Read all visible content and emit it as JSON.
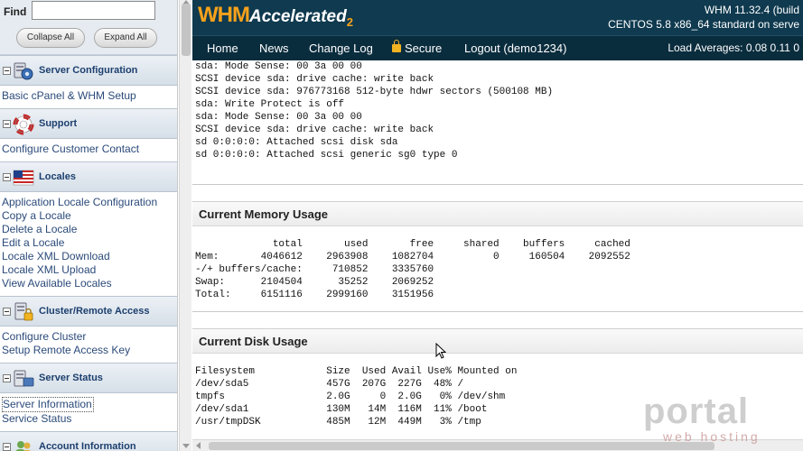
{
  "sidebar": {
    "find_label": "Find",
    "find_value": "",
    "collapse_label": "Collapse All",
    "expand_label": "Expand All",
    "sections": [
      {
        "title": "Server Configuration",
        "items": [
          "Basic cPanel & WHM Setup"
        ]
      },
      {
        "title": "Support",
        "items": [
          "Configure Customer Contact"
        ]
      },
      {
        "title": "Locales",
        "items": [
          "Application Locale Configuration",
          "Copy a Locale",
          "Delete a Locale",
          "Edit a Locale",
          "Locale XML Download",
          "Locale XML Upload",
          "View Available Locales"
        ]
      },
      {
        "title": "Cluster/Remote Access",
        "items": [
          "Configure Cluster",
          "Setup Remote Access Key"
        ]
      },
      {
        "title": "Server Status",
        "items": [
          "Server Information",
          "Service Status"
        ]
      },
      {
        "title": "Account Information",
        "items": []
      }
    ]
  },
  "header": {
    "logo_main": "WHM",
    "logo_accent": "Accelerated",
    "logo_num": "2",
    "version_line1": "WHM 11.32.4 (build",
    "version_line2": "CENTOS 5.8 x86_64 standard on serve"
  },
  "nav": {
    "items": [
      "Home",
      "News",
      "Change Log",
      "Secure",
      "Logout (demo1234)"
    ],
    "load_averages": "Load Averages: 0.08 0.11 0"
  },
  "dmesg": "sda: Mode Sense: 00 3a 00 00\nSCSI device sda: drive cache: write back\nSCSI device sda: 976773168 512-byte hdwr sectors (500108 MB)\nsda: Write Protect is off\nsda: Mode Sense: 00 3a 00 00\nSCSI device sda: drive cache: write back\nsd 0:0:0:0: Attached scsi disk sda\nsd 0:0:0:0: Attached scsi generic sg0 type 0",
  "memory": {
    "title": "Current Memory Usage",
    "text": "             total       used       free     shared    buffers     cached\nMem:       4046612    2963908    1082704          0     160504    2092552\n-/+ buffers/cache:     710852    3335760\nSwap:      2104504      35252    2069252\nTotal:     6151116    2999160    3151956"
  },
  "disk": {
    "title": "Current Disk Usage",
    "text": "Filesystem            Size  Used Avail Use% Mounted on\n/dev/sda5             457G  207G  227G  48% /\ntmpfs                 2.0G     0  2.0G   0% /dev/shm\n/dev/sda1             130M   14M  116M  11% /boot\n/usr/tmpDSK           485M   12M  449M   3% /tmp"
  },
  "watermark": {
    "main": "portal",
    "sub": "web hosting"
  },
  "colors": {
    "header_bg": "#0f3a4f",
    "nav_bg": "#0a2d3e",
    "logo_orange": "#f7a21b",
    "sidebar_link": "#2b4a7a"
  }
}
